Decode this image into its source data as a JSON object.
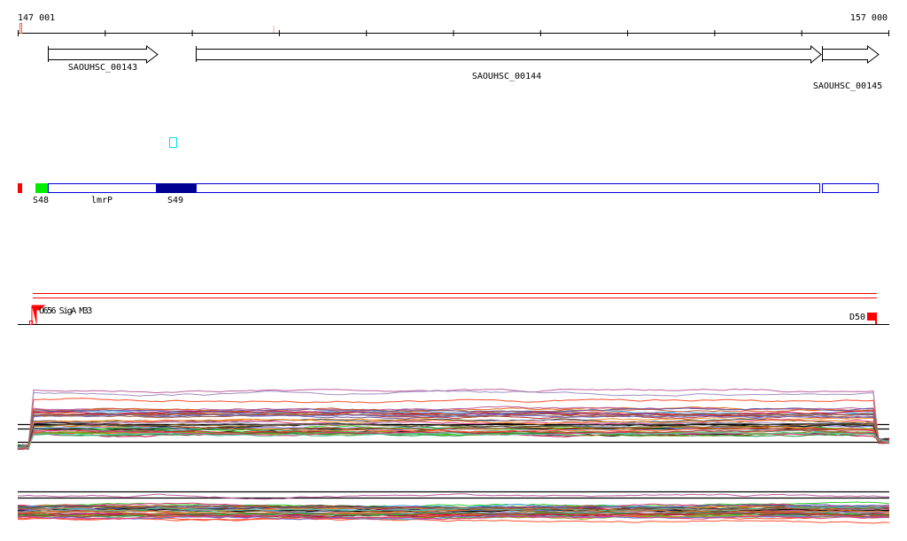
{
  "ruler": {
    "start_label": "147 001",
    "end_label": "157 000"
  },
  "genes": [
    {
      "name": "SAOUHSC_00143"
    },
    {
      "name": "SAOUHSC_00144"
    },
    {
      "name": "SAOUHSC_00145"
    }
  ],
  "segments": {
    "labels": [
      "S48",
      "lmrP",
      "S49"
    ]
  },
  "features": {
    "left_label": "U656 SigA M33",
    "right_label": "D50"
  },
  "colors": {
    "feature_red": "#ff0000",
    "segment_green": "#00ee00",
    "segment_navy": "#000090",
    "segment_outline": "#0000dd",
    "marker_cyan": "#00e5ee"
  },
  "series_colors": [
    "#c060a0",
    "#000000",
    "#a090c0",
    "#ff5030",
    "#e07020",
    "#4aa8e8",
    "#30d030",
    "#806020",
    "#c00040",
    "#90a020",
    "#d06030",
    "#6a5a9a",
    "#209040",
    "#b03030",
    "#f09030",
    "#7070d0",
    "#404040",
    "#e04080",
    "#60c0a0",
    "#a06040"
  ]
}
